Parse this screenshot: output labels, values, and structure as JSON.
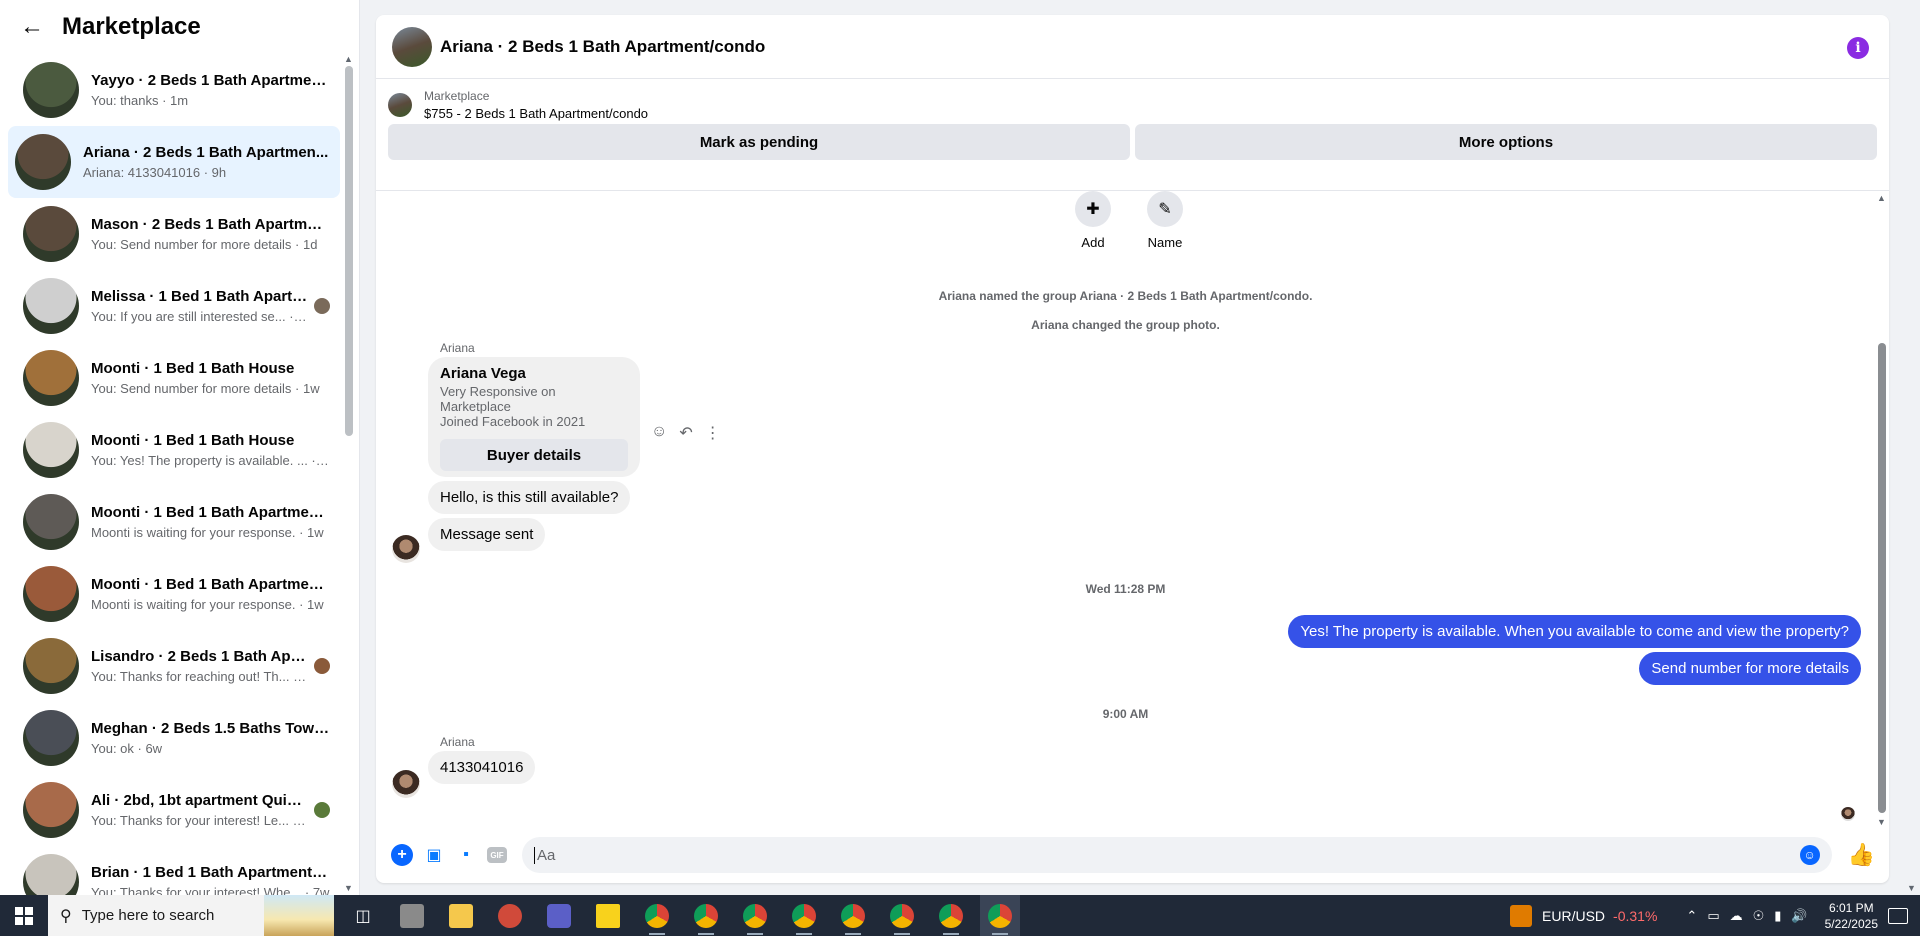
{
  "sidebar": {
    "title": "Marketplace",
    "conversations": [
      {
        "title": "Yayyo · 2 Beds 1 Bath Apartment...",
        "subtitle": "You: thanks · 1m",
        "color": "#4b5a3f",
        "mini": ""
      },
      {
        "title": "Ariana · 2 Beds 1 Bath Apartmen...",
        "subtitle": "Ariana: 4133041016 · 9h",
        "color": "#5a4a3c",
        "mini": ""
      },
      {
        "title": "Mason · 2 Beds 1 Bath Apartmen...",
        "subtitle": "You: Send number for more details · 1d",
        "color": "#5a4a3c",
        "mini": ""
      },
      {
        "title": "Melissa · 1 Bed 1 Bath Apartm...",
        "subtitle": "You: If you are still interested se... · 6d",
        "color": "#cfcfcf",
        "mini": "#7a6a5a"
      },
      {
        "title": "Moonti · 1 Bed 1 Bath House",
        "subtitle": "You: Send number for more details · 1w",
        "color": "#a0703a",
        "mini": ""
      },
      {
        "title": "Moonti · 1 Bed 1 Bath House",
        "subtitle": "You: Yes! The property is available. ... · 1w",
        "color": "#d8d4cc",
        "mini": ""
      },
      {
        "title": "Moonti · 1 Bed 1 Bath Apartmen...",
        "subtitle": "Moonti is waiting for your response. · 1w",
        "color": "#5e5a56",
        "mini": ""
      },
      {
        "title": "Moonti · 1 Bed 1 Bath Apartmen...",
        "subtitle": "Moonti is waiting for your response. · 1w",
        "color": "#9a5a3a",
        "mini": ""
      },
      {
        "title": "Lisandro · 2 Beds 1 Bath Apart...",
        "subtitle": "You: Thanks for reaching out! Th... · 3w",
        "color": "#8a6a3a",
        "mini": "#8a5a3a"
      },
      {
        "title": "Meghan · 2 Beds 1.5 Baths Town...",
        "subtitle": "You: ok · 6w",
        "color": "#4a4e56",
        "mini": ""
      },
      {
        "title": "Ali · 2bd, 1bt apartment Quiet...",
        "subtitle": "You: Thanks for your interest! Le... · 6w",
        "color": "#a86a4a",
        "mini": "#5a7a3a"
      },
      {
        "title": "Brian · 1 Bed 1 Bath Apartment/c...",
        "subtitle": "You: Thanks for your interest! Whe... · 7w",
        "color": "#c8c4bc",
        "mini": ""
      }
    ]
  },
  "chat": {
    "title": "Ariana · 2 Beds 1 Bath Apartment/condo",
    "listing_source": "Marketplace",
    "listing_price": "$755 - 2 Beds 1 Bath Apartment/condo",
    "mark_pending": "Mark as pending",
    "more_options": "More options",
    "add_label": "Add",
    "name_label": "Name",
    "system_1": "Ariana named the group Ariana · 2 Beds 1 Bath Apartment/condo.",
    "system_2": "Ariana changed the group photo.",
    "sender": "Ariana",
    "buyer_name": "Ariana Vega",
    "buyer_line1": "Very Responsive on Marketplace",
    "buyer_line2": "Joined Facebook in 2021",
    "buyer_details": "Buyer details",
    "msg_in_1": "Hello, is this still available?",
    "msg_in_2": "Message sent",
    "time_1": "Wed 11:28 PM",
    "msg_out_1": "Yes! The property is available. When you available to come and view the property?",
    "msg_out_2": "Send number for more details",
    "time_2": "9:00 AM",
    "msg_in_3": "4133041016",
    "composer_placeholder": "Aa"
  },
  "taskbar": {
    "search_placeholder": "Type here to search",
    "fx_pair": "EUR/USD",
    "fx_change": "-0.31%",
    "time": "6:01 PM",
    "date": "5/22/2025"
  },
  "colors": {
    "accent": "#0866ff",
    "outgoing_bubble": "#3552e8",
    "info": "#8a2be2"
  }
}
